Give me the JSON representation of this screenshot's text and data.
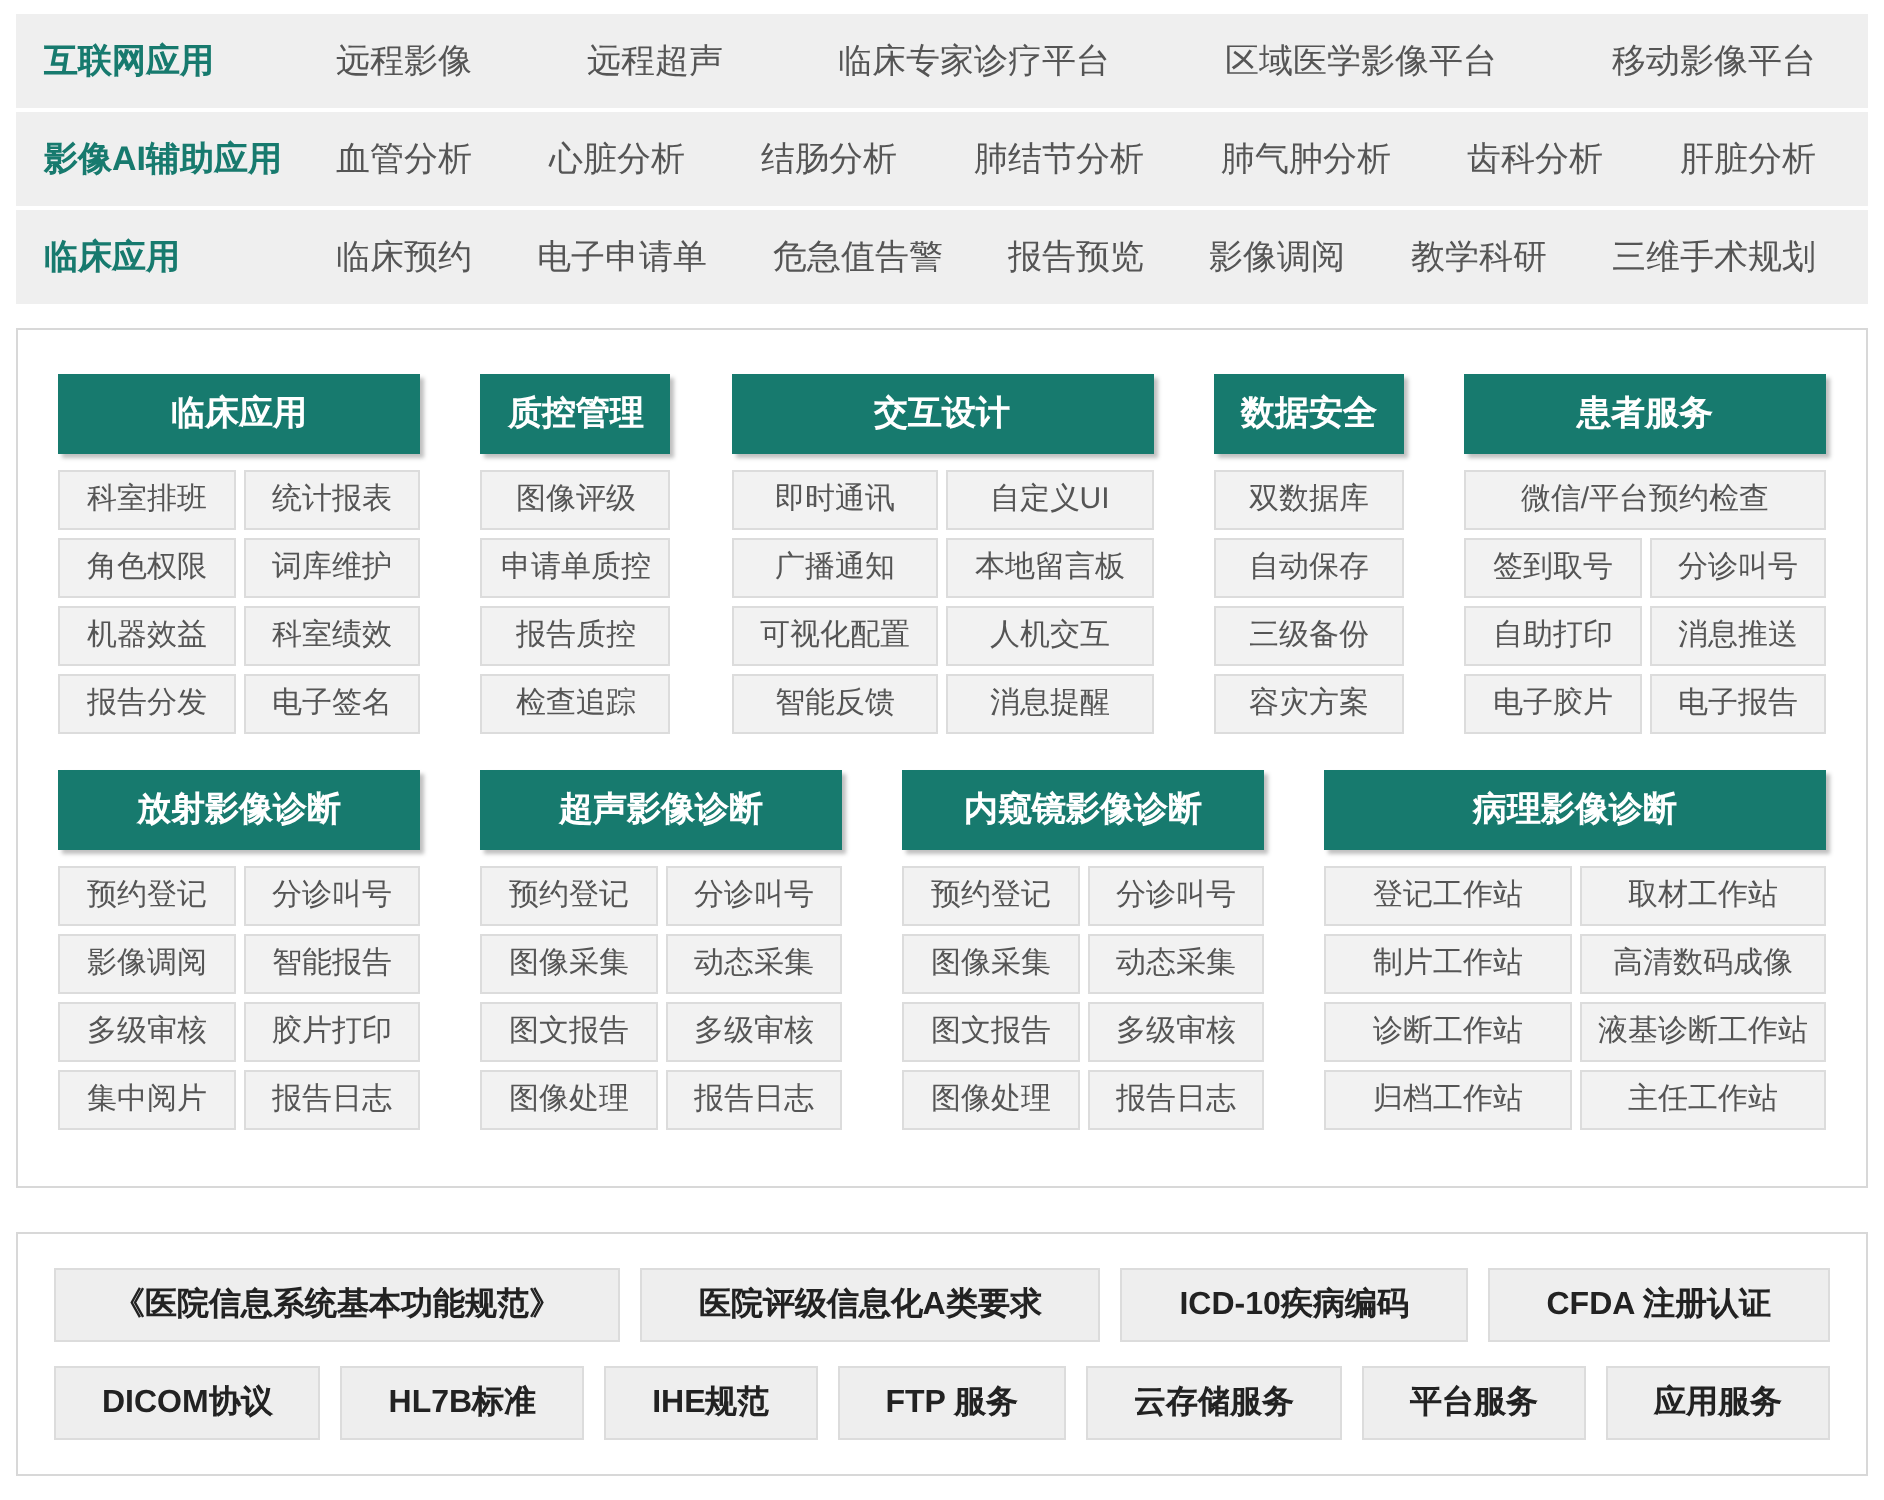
{
  "app_categories": [
    {
      "label": "互联网应用",
      "items": [
        "远程影像",
        "远程超声",
        "临床专家诊疗平台",
        "区域医学影像平台",
        "移动影像平台"
      ]
    },
    {
      "label": "影像AI辅助应用",
      "items": [
        "血管分析",
        "心脏分析",
        "结肠分析",
        "肺结节分析",
        "肺气肿分析",
        "齿科分析",
        "肝脏分析"
      ]
    },
    {
      "label": "临床应用",
      "items": [
        "临床预约",
        "电子申请单",
        "危急值告警",
        "报告预览",
        "影像调阅",
        "教学科研",
        "三维手术规划"
      ]
    }
  ],
  "module_rows": [
    [
      {
        "title": "临床应用",
        "items": [
          {
            "label": "科室排班"
          },
          {
            "label": "统计报表"
          },
          {
            "label": "角色权限"
          },
          {
            "label": "词库维护"
          },
          {
            "label": "机器效益"
          },
          {
            "label": "科室绩效"
          },
          {
            "label": "报告分发"
          },
          {
            "label": "电子签名"
          }
        ]
      },
      {
        "title": "质控管理",
        "items": [
          {
            "label": "图像评级"
          },
          {
            "label": "申请单质控"
          },
          {
            "label": "报告质控"
          },
          {
            "label": "检查追踪"
          }
        ]
      },
      {
        "title": "交互设计",
        "items": [
          {
            "label": "即时通讯"
          },
          {
            "label": "自定义UI"
          },
          {
            "label": "广播通知"
          },
          {
            "label": "本地留言板"
          },
          {
            "label": "可视化配置"
          },
          {
            "label": "人机交互"
          },
          {
            "label": "智能反馈"
          },
          {
            "label": "消息提醒"
          }
        ]
      },
      {
        "title": "数据安全",
        "items": [
          {
            "label": "双数据库"
          },
          {
            "label": "自动保存"
          },
          {
            "label": "三级备份"
          },
          {
            "label": "容灾方案"
          }
        ]
      },
      {
        "title": "患者服务",
        "items": [
          {
            "label": "微信/平台预约检查",
            "kind": "wide"
          },
          {
            "label": "签到取号",
            "kind": "normal"
          },
          {
            "label": "分诊叫号",
            "kind": "normal"
          },
          {
            "label": "自助打印",
            "kind": "normal"
          },
          {
            "label": "消息推送",
            "kind": "normal"
          },
          {
            "label": "电子胶片",
            "kind": "normal"
          },
          {
            "label": "电子报告",
            "kind": "normal"
          }
        ]
      }
    ],
    [
      {
        "title": "放射影像诊断",
        "items": [
          {
            "label": "预约登记"
          },
          {
            "label": "分诊叫号"
          },
          {
            "label": "影像调阅"
          },
          {
            "label": "智能报告"
          },
          {
            "label": "多级审核"
          },
          {
            "label": "胶片打印"
          },
          {
            "label": "集中阅片"
          },
          {
            "label": "报告日志"
          }
        ]
      },
      {
        "title": "超声影像诊断",
        "items": [
          {
            "label": "预约登记"
          },
          {
            "label": "分诊叫号"
          },
          {
            "label": "图像采集"
          },
          {
            "label": "动态采集"
          },
          {
            "label": "图文报告"
          },
          {
            "label": "多级审核"
          },
          {
            "label": "图像处理"
          },
          {
            "label": "报告日志"
          }
        ]
      },
      {
        "title": "内窥镜影像诊断",
        "items": [
          {
            "label": "预约登记"
          },
          {
            "label": "分诊叫号"
          },
          {
            "label": "图像采集"
          },
          {
            "label": "动态采集"
          },
          {
            "label": "图文报告"
          },
          {
            "label": "多级审核"
          },
          {
            "label": "图像处理"
          },
          {
            "label": "报告日志"
          }
        ]
      },
      {
        "title": "病理影像诊断",
        "items": [
          {
            "label": "登记工作站"
          },
          {
            "label": "取材工作站"
          },
          {
            "label": "制片工作站"
          },
          {
            "label": "高清数码成像"
          },
          {
            "label": "诊断工作站"
          },
          {
            "label": "液基诊断工作站"
          },
          {
            "label": "归档工作站"
          },
          {
            "label": "主任工作站"
          }
        ]
      }
    ]
  ],
  "standards": [
    [
      "《医院信息系统基本功能规范》",
      "医院评级信息化A类要求",
      "ICD-10疾病编码",
      "CFDA 注册认证"
    ],
    [
      "DICOM协议",
      "HL7B标准",
      "IHE规范",
      "FTP 服务",
      "云存储服务",
      "平台服务",
      "应用服务"
    ]
  ]
}
